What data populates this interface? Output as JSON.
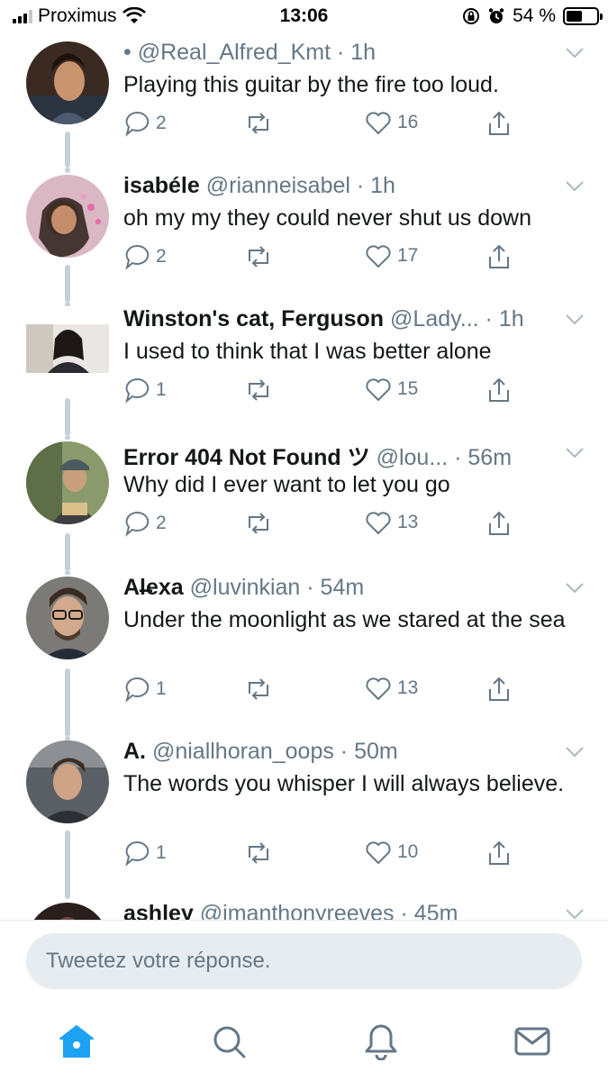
{
  "status_bar": {
    "carrier": "Proximus",
    "time": "13:06",
    "battery_percent": "54 %",
    "battery_level": 0.54
  },
  "tweets": [
    {
      "name": "",
      "handle": "• @Real_Alfred_Kmt",
      "time": "1h",
      "text": "Playing this guitar by the fire too loud.",
      "replies": "2",
      "likes": "16"
    },
    {
      "name": "isabéle",
      "handle": "@rianneisabel",
      "time": "1h",
      "text": "oh my my they could never shut us down",
      "replies": "2",
      "likes": "17"
    },
    {
      "name": "Winston's cat, Ferguson",
      "handle": "@Lady...",
      "time": "1h",
      "text": "I used to think that I was better alone",
      "replies": "1",
      "likes": "15"
    },
    {
      "name": "Error 404 Not Found ツ",
      "handle": "@lou...",
      "time": "56m",
      "text": "Why did I ever want to let you go",
      "replies": "2",
      "likes": "13"
    },
    {
      "name": "Al̶exa",
      "handle": "@luvinkian",
      "time": "54m",
      "text": "Under the moonlight as we stared at the sea",
      "replies": "1",
      "likes": "13"
    },
    {
      "name": "A.",
      "handle": "@niallhoran_oops",
      "time": "50m",
      "text": "The words you whisper I will always believe.",
      "replies": "1",
      "likes": "10"
    },
    {
      "name": "ashley",
      "handle": "@imanthonyreeves",
      "time": "45m",
      "text": "",
      "replies": "",
      "likes": ""
    }
  ],
  "reply_bar": {
    "placeholder": "Tweetez votre réponse."
  },
  "tab_bar": {
    "items": [
      "home-icon",
      "search-icon",
      "notifications-icon",
      "messages-icon"
    ],
    "active_color": "#1da1f2"
  },
  "colors": {
    "text": "#14171a",
    "secondary": "#657786",
    "thread_line": "#c5d1da",
    "accent": "#1da1f2"
  }
}
